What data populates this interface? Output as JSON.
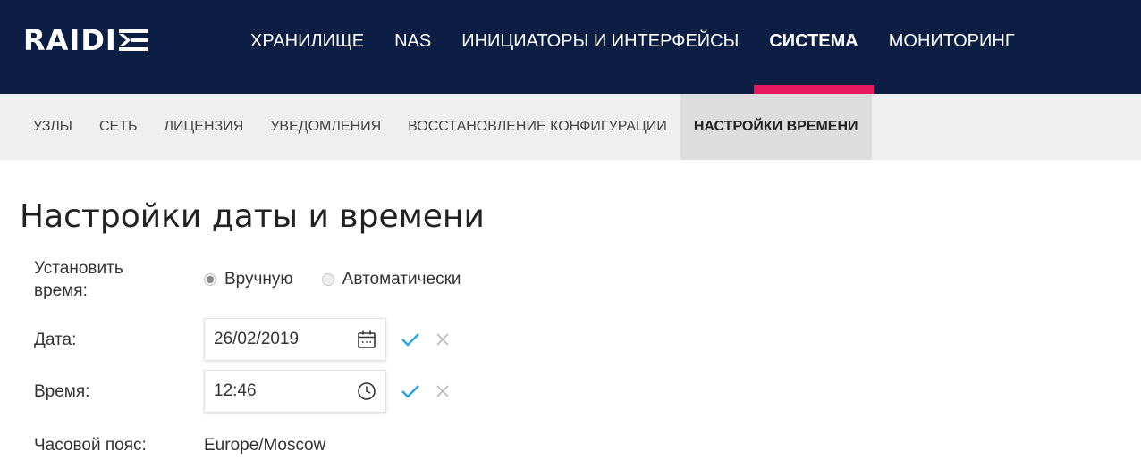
{
  "brand": {
    "logo_text": "RAIDI"
  },
  "topnav": {
    "items": [
      {
        "label": "ХРАНИЛИЩЕ",
        "active": false
      },
      {
        "label": "NAS",
        "active": false
      },
      {
        "label": "ИНИЦИАТОРЫ И ИНТЕРФЕЙСЫ",
        "active": false
      },
      {
        "label": "СИСТЕМА",
        "active": true
      },
      {
        "label": "МОНИТОРИНГ",
        "active": false
      }
    ]
  },
  "subnav": {
    "items": [
      {
        "label": "УЗЛЫ",
        "active": false
      },
      {
        "label": "СЕТЬ",
        "active": false
      },
      {
        "label": "ЛИЦЕНЗИЯ",
        "active": false
      },
      {
        "label": "УВЕДОМЛЕНИЯ",
        "active": false
      },
      {
        "label": "ВОССТАНОВЛЕНИЕ КОНФИГУРАЦИИ",
        "active": false
      },
      {
        "label": "НАСТРОЙКИ ВРЕМЕНИ",
        "active": true
      }
    ]
  },
  "page": {
    "title": "Настройки даты и времени",
    "set_time": {
      "label_line1": "Установить",
      "label_line2": "время:",
      "options": [
        {
          "label": "Вручную",
          "checked": true
        },
        {
          "label": "Автоматически",
          "checked": false
        }
      ]
    },
    "date": {
      "label": "Дата:",
      "value": "26/02/2019",
      "icon": "calendar-icon"
    },
    "time": {
      "label": "Время:",
      "value": "12:46",
      "icon": "clock-icon"
    },
    "timezone": {
      "label": "Часовой пояс:",
      "value": "Europe/Moscow"
    }
  },
  "colors": {
    "nav_bg": "#0c1e44",
    "accent": "#e8185e",
    "confirm": "#2aa3e6",
    "cancel": "#bbbbbb",
    "subnav_bg": "#efefef",
    "subnav_active_bg": "#dddddd"
  }
}
